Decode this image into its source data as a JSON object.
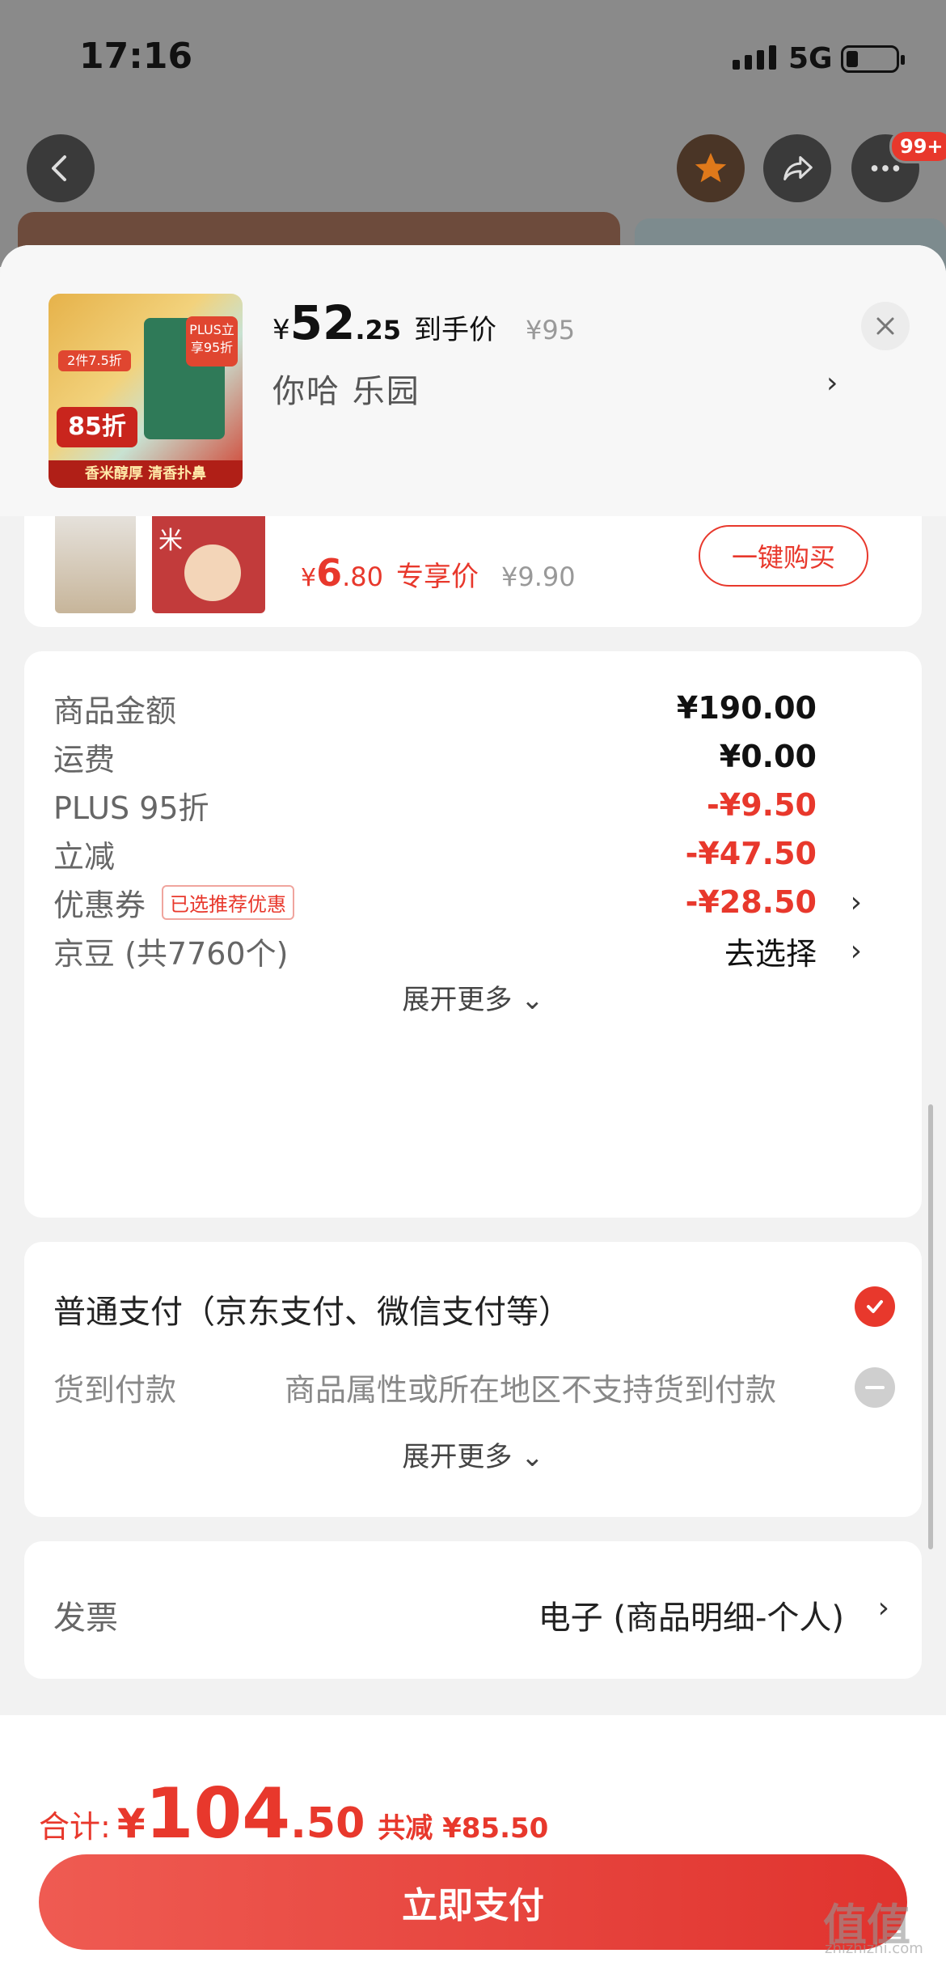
{
  "status_bar": {
    "time": "17:16",
    "network": "5G"
  },
  "top_nav": {
    "badge": "99+"
  },
  "product_header": {
    "price_currency": "¥",
    "price_integer": "52",
    "price_decimal": ".25",
    "price_label": "到手价",
    "original_price": "¥95",
    "spec": "你哈  乐园",
    "image_texts": {
      "coupon": "2件7.5折",
      "discount": "85折",
      "plus": "PLUS立享95折",
      "slogan": "香米醇厚 清香扑鼻"
    }
  },
  "recommend": {
    "price_currency": "¥",
    "price_integer": "6",
    "price_decimal": ".80",
    "price_label": "专享价",
    "original_price": "¥9.90",
    "buy_label": "一键购买",
    "image_text": "米"
  },
  "amounts": {
    "rows": [
      {
        "label": "商品金额",
        "value": "¥190.00"
      },
      {
        "label": "运费",
        "value": "¥0.00"
      },
      {
        "label": "PLUS 95折",
        "value": "-¥9.50"
      },
      {
        "label": "立减",
        "value": "-¥47.50"
      },
      {
        "label": "优惠券",
        "tag": "已选推荐优惠",
        "value": "-¥28.50"
      },
      {
        "label": "京豆 (共7760个)",
        "value": "去选择"
      }
    ],
    "expand_label": "展开更多 ⌄"
  },
  "payment": {
    "option1": "普通支付（京东支付、微信支付等）",
    "option2": "货到付款",
    "option2_note": "商品属性或所在地区不支持货到付款",
    "expand_label": "展开更多 ⌄"
  },
  "invoice": {
    "label": "发票",
    "value": "电子 (商品明细-个人)"
  },
  "footer": {
    "total_label": "合计:",
    "total_currency": "¥",
    "total_integer": "104",
    "total_decimal": ".50",
    "saved": "共减 ¥85.50",
    "pay_button": "立即支付"
  },
  "watermark": {
    "main": "值值值",
    "sub": "zhizhizhi.com"
  },
  "colors": {
    "accent": "#e8382c",
    "background": "#f2f2f2"
  }
}
